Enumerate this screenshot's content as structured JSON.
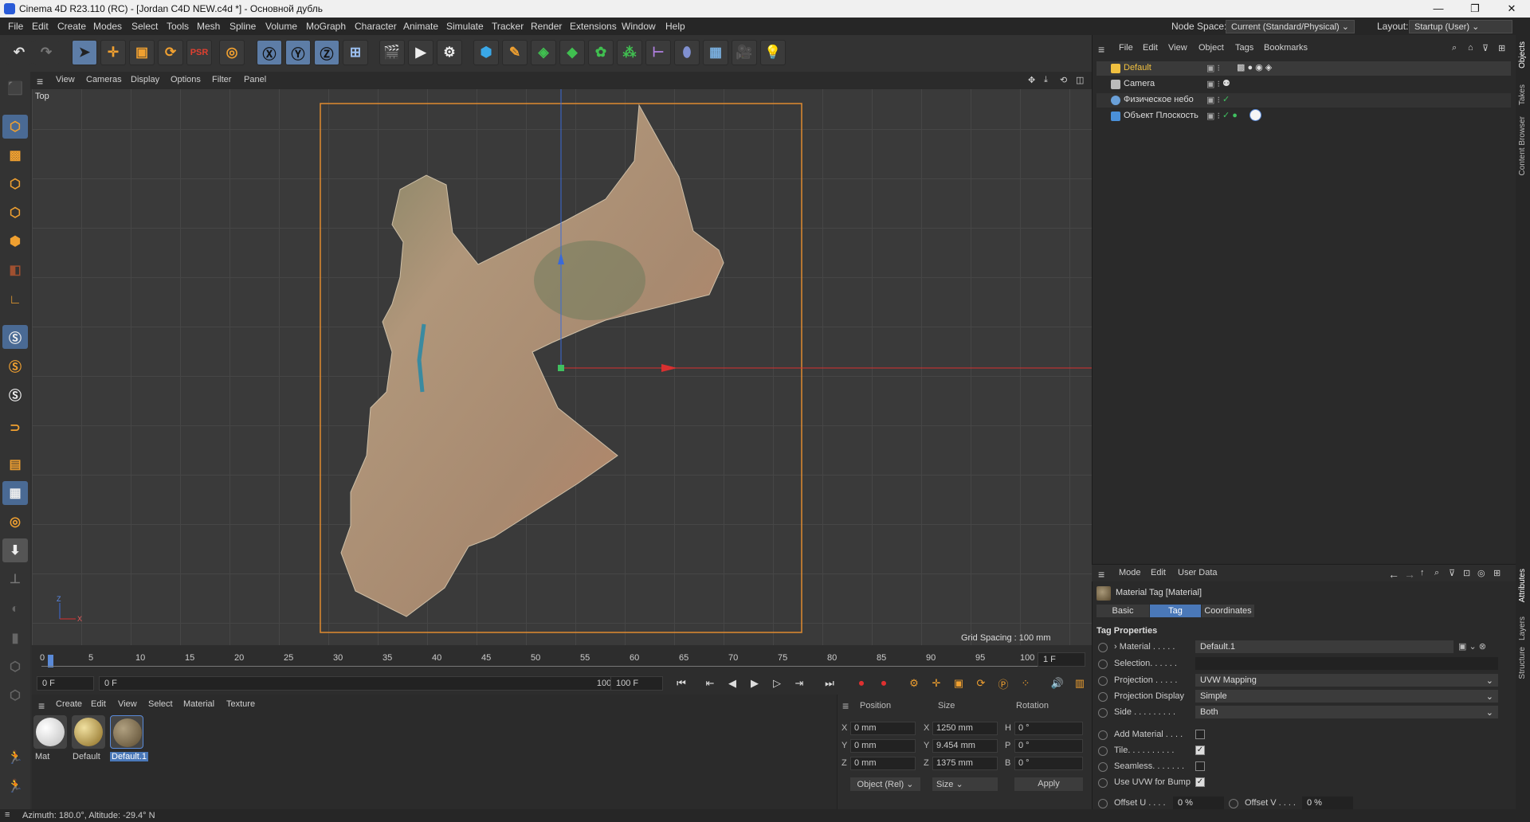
{
  "titlebar": {
    "title": "Cinema 4D R23.110 (RC) - [Jordan C4D NEW.c4d *] - Основной дубль",
    "minimize": "—",
    "maximize": "❐",
    "close": "✕"
  },
  "menubar": {
    "items": [
      "File",
      "Edit",
      "Create",
      "Modes",
      "Select",
      "Tools",
      "Mesh",
      "Spline",
      "Volume",
      "MoGraph",
      "Character",
      "Animate",
      "Simulate",
      "Tracker",
      "Render",
      "Extensions",
      "Window",
      "Help"
    ],
    "node_space_label": "Node Space:",
    "node_space_value": "Current (Standard/Physical)",
    "layout_label": "Layout:",
    "layout_value": "Startup (User)"
  },
  "viewport": {
    "menu": [
      "View",
      "Cameras",
      "Display",
      "Options",
      "Filter",
      "Panel"
    ],
    "view_name": "Top",
    "grid_spacing": "Grid Spacing : 100 mm",
    "axis_x": "X",
    "axis_z": "Z"
  },
  "timeline": {
    "ticks": [
      "0",
      "5",
      "10",
      "15",
      "20",
      "25",
      "30",
      "35",
      "40",
      "45",
      "50",
      "55",
      "60",
      "65",
      "70",
      "75",
      "80",
      "85",
      "90",
      "95",
      "100"
    ],
    "current_frame": "1 F"
  },
  "transport": {
    "start": "0 F",
    "current": "0 F",
    "end_range": "100 F",
    "end": "100 F"
  },
  "materials": {
    "menu": [
      "Create",
      "Edit",
      "View",
      "Select",
      "Material",
      "Texture"
    ],
    "items": [
      {
        "label": "Mat"
      },
      {
        "label": "Default"
      },
      {
        "label": "Default.1"
      }
    ]
  },
  "coordinates": {
    "headers": {
      "position": "Position",
      "size": "Size",
      "rotation": "Rotation"
    },
    "rows": [
      {
        "axis": "X",
        "pos": "0 mm",
        "size_axis": "X",
        "size": "1250 mm",
        "rot_axis": "H",
        "rot": "0 °"
      },
      {
        "axis": "Y",
        "pos": "0 mm",
        "size_axis": "Y",
        "size": "9.454 mm",
        "rot_axis": "P",
        "rot": "0 °"
      },
      {
        "axis": "Z",
        "pos": "0 mm",
        "size_axis": "Z",
        "size": "1375 mm",
        "rot_axis": "B",
        "rot": "0 °"
      }
    ],
    "mode": "Object (Rel)",
    "size_mode": "Size",
    "apply": "Apply"
  },
  "objects": {
    "menu": [
      "File",
      "Edit",
      "View",
      "Object",
      "Tags",
      "Bookmarks"
    ],
    "items": [
      {
        "name": "Default",
        "color": "#f0c040"
      },
      {
        "name": "Camera",
        "color": "#bbbbbb"
      },
      {
        "name": "Физическое небо",
        "color": "#6aa0d8"
      },
      {
        "name": "Объект Плоскость",
        "color": "#4a90d9"
      }
    ]
  },
  "vtabs": [
    "Objects",
    "Takes",
    "Content Browser",
    "Attributes",
    "Layers",
    "Structure"
  ],
  "attributes": {
    "menu": [
      "Mode",
      "Edit",
      "User Data"
    ],
    "object_title": "Material Tag [Material]",
    "tabs": [
      "Basic",
      "Tag",
      "Coordinates"
    ],
    "section": "Tag Properties",
    "props": [
      {
        "label": "› Material . . . . .",
        "value": "Default.1"
      },
      {
        "label": "Selection. . . . . .",
        "value": ""
      },
      {
        "label": "Projection . . . . .",
        "value": "UVW Mapping"
      },
      {
        "label": "Projection Display",
        "value": "Simple"
      },
      {
        "label": "Side . . . . . . . . .",
        "value": "Both"
      }
    ],
    "checks": [
      {
        "label": "Add Material . . . .",
        "checked": false,
        "mark": ""
      },
      {
        "label": "Tile. . . . . . . . . .",
        "checked": true,
        "mark": "✓"
      },
      {
        "label": "Seamless. . . . . . .",
        "checked": false,
        "mark": ""
      },
      {
        "label": "Use UVW for Bump",
        "checked": true,
        "mark": "✓"
      }
    ],
    "offset_u_label": "Offset U . . . .",
    "offset_u": "0 %",
    "offset_v_label": "Offset V . . . .",
    "offset_v": "0 %"
  },
  "statusbar": {
    "text": "Azimuth: 180.0°, Altitude: -29.4°  N"
  }
}
